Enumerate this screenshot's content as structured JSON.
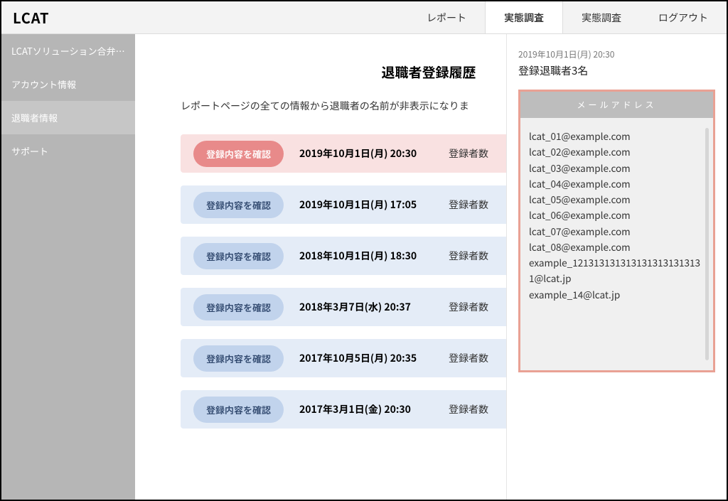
{
  "app_title": "LCAT",
  "nav": {
    "report": "レポート",
    "survey1": "実態調査",
    "survey2": "実態調査",
    "logout": "ログアウト"
  },
  "sidebar": {
    "items": [
      {
        "label": "LCATソリューション合弁会…"
      },
      {
        "label": "アカウント情報"
      },
      {
        "label": "退職者情報"
      },
      {
        "label": "サポート"
      }
    ]
  },
  "main": {
    "title": "退職者登録履歴",
    "description": "レポートページの全ての情報から退職者の名前が非表示になりま",
    "confirm_label": "登録内容を確認",
    "count_label": "登録者数",
    "rows": [
      {
        "date": "2019年10月1日(月) 20:30"
      },
      {
        "date": "2019年10月1日(月) 17:05"
      },
      {
        "date": "2018年10月1日(月) 18:30"
      },
      {
        "date": "2018年3月7日(水) 20:37"
      },
      {
        "date": "2017年10月5日(月) 20:35"
      },
      {
        "date": "2017年3月1日(金) 20:30"
      }
    ]
  },
  "panel": {
    "meta_date": "2019年10月1日(月) 20:30",
    "meta_title": "登録退職者3名",
    "card_header": "メールアドレス",
    "emails": [
      "lcat_01@example.com",
      "lcat_02@example.com",
      "lcat_03@example.com",
      "lcat_04@example.com",
      "lcat_05@example.com",
      "lcat_06@example.com",
      "lcat_07@example.com",
      "lcat_08@example.com",
      "example_1213131313131313131313131@lcat.jp",
      "example_14@lcat.jp"
    ]
  }
}
